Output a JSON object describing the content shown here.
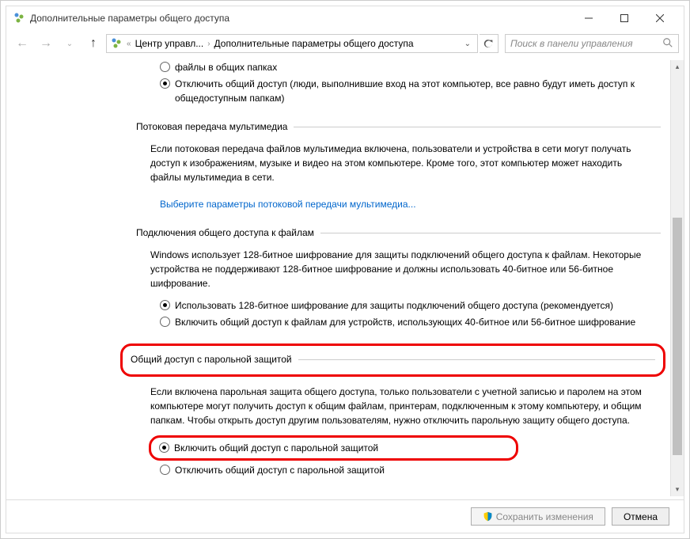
{
  "window": {
    "title": "Дополнительные параметры общего доступа"
  },
  "nav": {
    "breadcrumb": {
      "part1": "Центр управл...",
      "part2": "Дополнительные параметры общего доступа"
    },
    "search_placeholder": "Поиск в панели управления"
  },
  "content": {
    "folder_radio_truncated": "файлы в общих папках",
    "folder_radio_off": "Отключить общий доступ (люди, выполнившие вход на этот компьютер, все равно будут иметь доступ к общедоступным папкам)",
    "media": {
      "header": "Потоковая передача мультимедиа",
      "desc": "Если потоковая передача файлов мультимедиа включена, пользователи и устройства в сети могут получать доступ к изображениям, музыке и видео на этом компьютере. Кроме того, этот компьютер может находить файлы мультимедиа в сети.",
      "link": "Выберите параметры потоковой передачи мультимедиа..."
    },
    "encryption": {
      "header": "Подключения общего доступа к файлам",
      "desc": "Windows использует 128-битное шифрование для защиты подключений общего доступа к файлам. Некоторые устройства не поддерживают 128-битное шифрование и должны использовать 40-битное или 56-битное шифрование.",
      "radio_128": "Использовать 128-битное шифрование для защиты подключений общего доступа (рекомендуется)",
      "radio_40": "Включить общий доступ к файлам для устройств, использующих 40-битное или 56-битное шифрование"
    },
    "password": {
      "header": "Общий доступ с парольной защитой",
      "desc": "Если включена парольная защита общего доступа, только пользователи с учетной записью и паролем на этом компьютере могут получить доступ к общим файлам, принтерам, подключенным к этому компьютеру, и общим папкам. Чтобы открыть доступ другим пользователям, нужно отключить парольную защиту общего доступа.",
      "radio_on": "Включить общий доступ с парольной защитой",
      "radio_off": "Отключить общий доступ с парольной защитой"
    }
  },
  "buttons": {
    "save": "Сохранить изменения",
    "cancel": "Отмена"
  }
}
